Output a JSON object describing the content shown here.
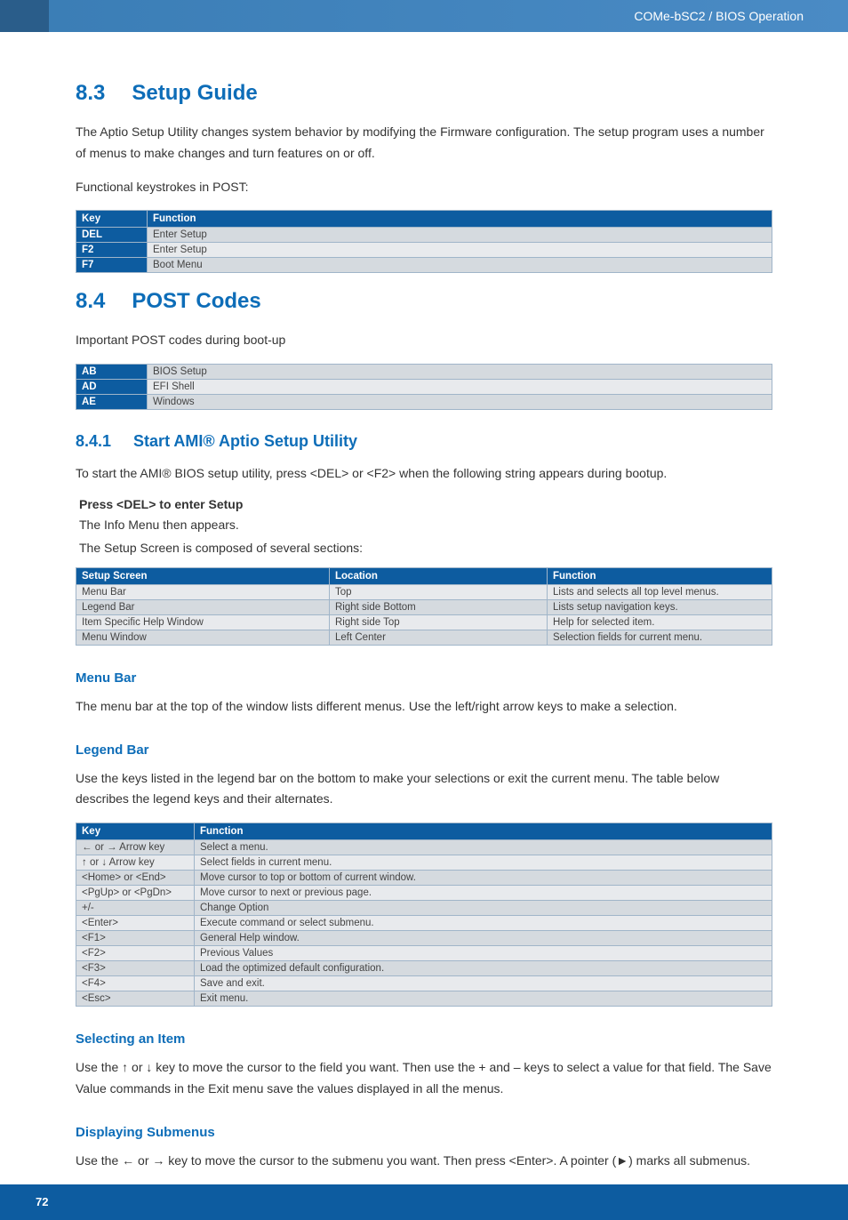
{
  "header": {
    "breadcrumb": "COMe-bSC2 / BIOS Operation"
  },
  "section83": {
    "num": "8.3",
    "title": "Setup Guide",
    "para1": "The Aptio Setup Utility changes system behavior by modifying the Firmware configuration. The setup program uses a number of menus to make changes and turn features on or off.",
    "para2": "Functional keystrokes in POST:"
  },
  "table1": {
    "head": {
      "c1": "Key",
      "c2": "Function"
    },
    "rows": [
      {
        "c1": "DEL",
        "c2": "Enter Setup"
      },
      {
        "c1": "F2",
        "c2": "Enter Setup"
      },
      {
        "c1": "F7",
        "c2": "Boot Menu"
      }
    ]
  },
  "section84": {
    "num": "8.4",
    "title": "POST Codes",
    "para1": "Important POST codes during boot-up"
  },
  "table2": {
    "rows": [
      {
        "c1": "AB",
        "c2": "BIOS Setup"
      },
      {
        "c1": "AD",
        "c2": "EFI Shell"
      },
      {
        "c1": "AE",
        "c2": "Windows"
      }
    ]
  },
  "section841": {
    "num": "8.4.1",
    "title": "Start AMI® Aptio Setup Utility",
    "para1": "To start the AMI® BIOS setup utility, press <DEL> or <F2> when the following string appears during bootup.",
    "bold": "Press <DEL> to enter Setup",
    "line1": "The Info Menu then appears.",
    "line2": "The Setup Screen is composed of several sections:"
  },
  "table3": {
    "head": {
      "c1": "Setup Screen",
      "c2": "Location",
      "c3": "Function"
    },
    "rows": [
      {
        "c1": "Menu Bar",
        "c2": "Top",
        "c3": "Lists and selects all top level menus."
      },
      {
        "c1": "Legend Bar",
        "c2": "Right side Bottom",
        "c3": "Lists setup navigation keys."
      },
      {
        "c1": "Item Specific Help Window",
        "c2": "Right side Top",
        "c3": "Help for selected item."
      },
      {
        "c1": "Menu Window",
        "c2": "Left Center",
        "c3": "Selection fields for current menu."
      }
    ]
  },
  "menubar": {
    "title": "Menu Bar",
    "para": "The menu bar at the top of the window lists different menus. Use the left/right arrow keys to make a selection."
  },
  "legendbar": {
    "title": "Legend Bar",
    "para": "Use the keys listed in the legend bar on the bottom to make your selections or exit the current menu. The table below describes the legend keys and their alternates."
  },
  "table4": {
    "head": {
      "c1": "Key",
      "c2": "Function"
    },
    "rows": [
      {
        "c1": "← or → Arrow key",
        "c2": "Select a menu."
      },
      {
        "c1": "↑ or ↓ Arrow key",
        "c2": "Select fields in current menu."
      },
      {
        "c1": "<Home> or <End>",
        "c2": "Move cursor to top or bottom of current window."
      },
      {
        "c1": "<PgUp> or <PgDn>",
        "c2": "Move cursor to next or previous page."
      },
      {
        "c1": "+/-",
        "c2": "Change Option"
      },
      {
        "c1": "<Enter>",
        "c2": "Execute command or select submenu."
      },
      {
        "c1": "<F1>",
        "c2": "General Help window."
      },
      {
        "c1": "<F2>",
        "c2": "Previous Values"
      },
      {
        "c1": "<F3>",
        "c2": "Load the optimized default configuration."
      },
      {
        "c1": "<F4>",
        "c2": "Save and exit."
      },
      {
        "c1": "<Esc>",
        "c2": "Exit menu."
      }
    ]
  },
  "selecting": {
    "title": "Selecting an Item",
    "para": "Use the ↑ or ↓ key to move the cursor to the field you want. Then use the + and – keys to select a value for that field. The Save Value commands in the Exit menu save the values displayed in all the menus."
  },
  "submenus": {
    "title": "Displaying Submenus",
    "para": "Use the ← or → key to move the cursor to the submenu you want. Then press <Enter>. A pointer (►) marks all submenus."
  },
  "footer": {
    "page": "72"
  }
}
